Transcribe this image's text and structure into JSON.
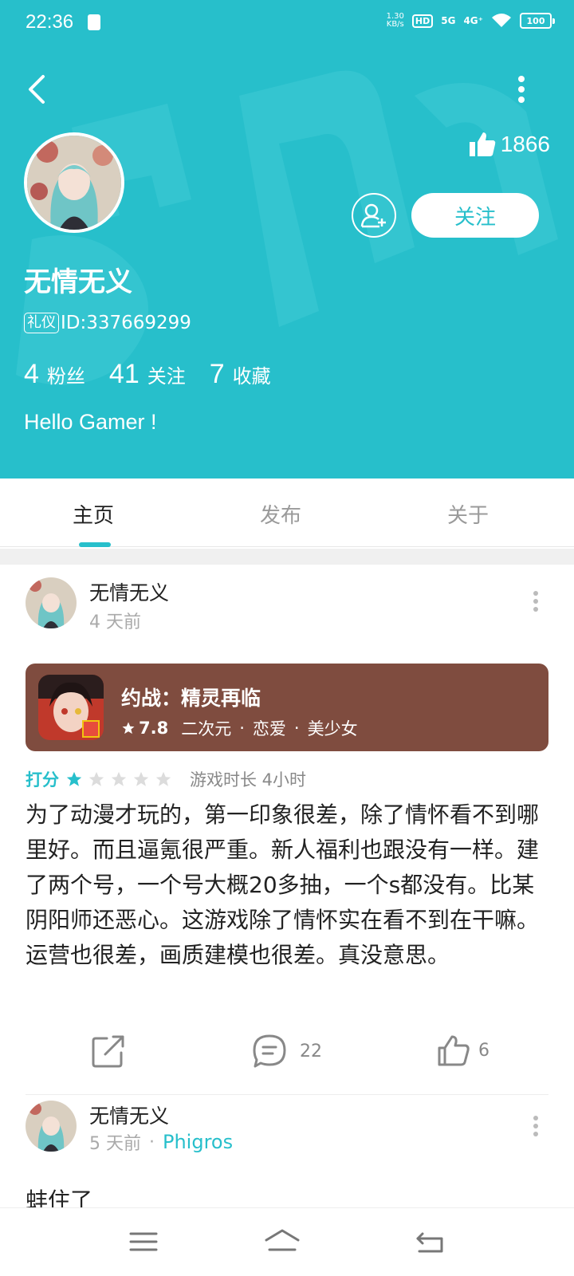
{
  "status_bar": {
    "time": "22:36",
    "speed_top": "1.30",
    "speed_bottom": "KB/s",
    "hd_label": "HD",
    "net_5g": "5G",
    "net_4g": "4G⁺",
    "battery": "100"
  },
  "colors": {
    "accent": "#27bfcb",
    "card_bg": "#7f4c3f",
    "star_inactive": "#dcdcdc"
  },
  "profile": {
    "likes": "1866",
    "follow_label": "关注",
    "name": "无情无义",
    "tag": "礼仪",
    "id_text": "ID:337669299",
    "stats": [
      {
        "num": "4",
        "label": "粉丝"
      },
      {
        "num": "41",
        "label": "关注"
      },
      {
        "num": "7",
        "label": "收藏"
      }
    ],
    "bio": "Hello Gamer !"
  },
  "tabs": [
    {
      "label": "主页",
      "active": true
    },
    {
      "label": "发布",
      "active": false
    },
    {
      "label": "关于",
      "active": false
    }
  ],
  "posts": [
    {
      "author": "无情无义",
      "time": "4 天前",
      "game": {
        "title": "约战：精灵再临",
        "score": "7.8",
        "tags": [
          "二次元",
          "恋爱",
          "美少女"
        ]
      },
      "rating_label": "打分",
      "rating": 1,
      "rating_max": 5,
      "play_time": "游戏时长 4小时",
      "body": "为了动漫才玩的，第一印象很差，除了情怀看不到哪里好。而且逼氪很严重。新人福利也跟没有一样。建了两个号，一个号大概20多抽，一个s都没有。比某阴阳师还恶心。这游戏除了情怀实在看不到在干嘛。运营也很差，画质建模也很差。真没意思。",
      "comments": "22",
      "likes": "6"
    },
    {
      "author": "无情无义",
      "time": "5 天前",
      "game_link": "Phigros",
      "body_partial": "蚌住了"
    }
  ]
}
